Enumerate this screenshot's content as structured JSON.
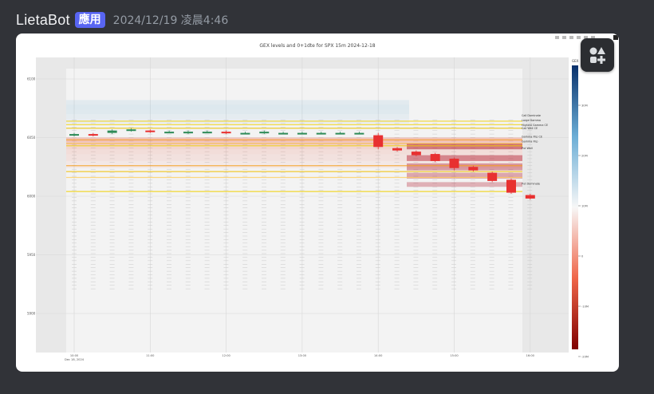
{
  "message": {
    "author": "LietaBot",
    "badge": "應用",
    "timestamp": "2024/12/19 凌晨4:46"
  },
  "colors": {
    "background": "#313338",
    "badge": "#5865f2",
    "card": "#ffffff"
  },
  "icons": {
    "floating_button": "apps-icon"
  },
  "chart_data": {
    "type": "heatmap",
    "title": "GEX levels and 0+1dte for SPX 15m 2024-12-18",
    "x_ticks": [
      "10:00\nDec 18, 2024",
      "11:00",
      "12:00",
      "13:00",
      "14:00",
      "15:00",
      "16:00"
    ],
    "y_ticks": [
      "6100",
      "6050",
      "6000",
      "5950",
      "5900"
    ],
    "colorbar": {
      "title": "GEX",
      "ticks": [
        "30M",
        "20M",
        "10M",
        "0",
        "-10M",
        "-20M"
      ],
      "colorscale": [
        "#08306b",
        "#6baed6",
        "#f7f7f7",
        "#ef6548",
        "#7f0000"
      ]
    },
    "level_labels": [
      "Call Dominate",
      "Large Gamma",
      "Highest Gamma CE",
      "Call Wall CE",
      "Gamma Flip CE",
      "Gamma Flip",
      "Put Wall",
      "Put Dominate"
    ],
    "candles": [
      {
        "t": "10:00",
        "o": 6052,
        "c": 6053,
        "h": 6054,
        "l": 6051
      },
      {
        "t": "10:15",
        "o": 6053,
        "c": 6052,
        "h": 6054,
        "l": 6051
      },
      {
        "t": "10:30",
        "o": 6054,
        "c": 6056,
        "h": 6057,
        "l": 6053
      },
      {
        "t": "10:45",
        "o": 6056,
        "c": 6057,
        "h": 6058,
        "l": 6055
      },
      {
        "t": "11:00",
        "o": 6056,
        "c": 6055,
        "h": 6057,
        "l": 6054
      },
      {
        "t": "11:15",
        "o": 6055,
        "c": 6055,
        "h": 6056,
        "l": 6054
      },
      {
        "t": "11:30",
        "o": 6054,
        "c": 6055,
        "h": 6056,
        "l": 6053
      },
      {
        "t": "11:45",
        "o": 6055,
        "c": 6055,
        "h": 6056,
        "l": 6054
      },
      {
        "t": "12:00",
        "o": 6055,
        "c": 6054,
        "h": 6056,
        "l": 6053
      },
      {
        "t": "12:15",
        "o": 6054,
        "c": 6054,
        "h": 6055,
        "l": 6053
      },
      {
        "t": "12:30",
        "o": 6054,
        "c": 6055,
        "h": 6056,
        "l": 6053
      },
      {
        "t": "12:45",
        "o": 6054,
        "c": 6054,
        "h": 6055,
        "l": 6053
      },
      {
        "t": "13:00",
        "o": 6054,
        "c": 6054,
        "h": 6055,
        "l": 6053
      },
      {
        "t": "13:15",
        "o": 6054,
        "c": 6054,
        "h": 6055,
        "l": 6053
      },
      {
        "t": "13:30",
        "o": 6054,
        "c": 6054,
        "h": 6055,
        "l": 6053
      },
      {
        "t": "13:45",
        "o": 6054,
        "c": 6054,
        "h": 6055,
        "l": 6053
      },
      {
        "t": "14:00",
        "o": 6052,
        "c": 6042,
        "h": 6054,
        "l": 6040
      },
      {
        "t": "14:15",
        "o": 6041,
        "c": 6039,
        "h": 6042,
        "l": 6038
      },
      {
        "t": "14:30",
        "o": 6038,
        "c": 6035,
        "h": 6039,
        "l": 6034
      },
      {
        "t": "14:45",
        "o": 6036,
        "c": 6030,
        "h": 6037,
        "l": 6029
      },
      {
        "t": "15:00",
        "o": 6032,
        "c": 6024,
        "h": 6033,
        "l": 6022
      },
      {
        "t": "15:15",
        "o": 6025,
        "c": 6022,
        "h": 6026,
        "l": 6021
      },
      {
        "t": "15:30",
        "o": 6020,
        "c": 6013,
        "h": 6021,
        "l": 6012
      },
      {
        "t": "15:45",
        "o": 6014,
        "c": 6003,
        "h": 6015,
        "l": 6002
      },
      {
        "t": "16:00",
        "o": 6001,
        "c": 5998,
        "h": 6002,
        "l": 5997
      }
    ]
  }
}
